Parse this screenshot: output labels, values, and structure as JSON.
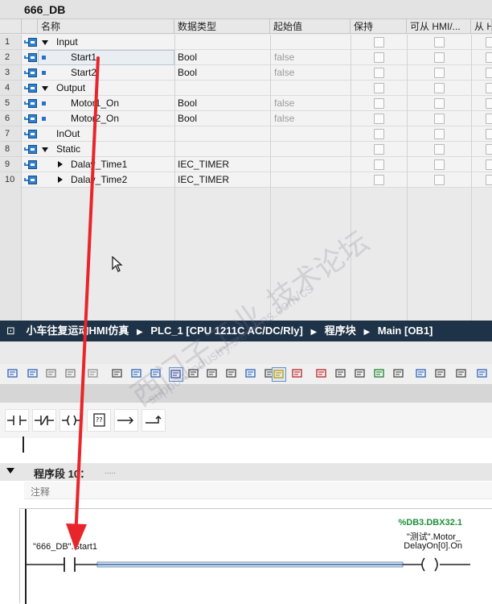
{
  "db": {
    "title": "666_DB",
    "columns": [
      "名称",
      "数据类型",
      "起始值",
      "保持",
      "可从 HMI/...",
      "从 H"
    ],
    "rows": [
      {
        "num": "1",
        "name": "Input",
        "type": "",
        "start": "",
        "level": 0,
        "expander": "down"
      },
      {
        "num": "2",
        "name": "Start1",
        "type": "Bool",
        "start": "false",
        "level": 1,
        "expander": "none"
      },
      {
        "num": "3",
        "name": "Start2",
        "type": "Bool",
        "start": "false",
        "level": 1,
        "expander": "none"
      },
      {
        "num": "4",
        "name": "Output",
        "type": "",
        "start": "",
        "level": 0,
        "expander": "down"
      },
      {
        "num": "5",
        "name": "Motor1_On",
        "type": "Bool",
        "start": "false",
        "level": 1,
        "expander": "none"
      },
      {
        "num": "6",
        "name": "Motor2_On",
        "type": "Bool",
        "start": "false",
        "level": 1,
        "expander": "none"
      },
      {
        "num": "7",
        "name": "InOut",
        "type": "",
        "start": "",
        "level": 0,
        "expander": "none"
      },
      {
        "num": "8",
        "name": "Static",
        "type": "",
        "start": "",
        "level": 0,
        "expander": "down"
      },
      {
        "num": "9",
        "name": "Dalay_Time1",
        "type": "IEC_TIMER",
        "start": "",
        "level": 1,
        "expander": "right"
      },
      {
        "num": "10",
        "name": "Dalay_Time2",
        "type": "IEC_TIMER",
        "start": "",
        "level": 1,
        "expander": "right"
      }
    ]
  },
  "breadcrumb": {
    "project": "小车往复运动HMI仿真",
    "plc": "PLC_1 [CPU 1211C AC/DC/Rly]",
    "folder": "程序块",
    "block": "Main [OB1]"
  },
  "network": {
    "title": "程序段 10：",
    "dots": ".....",
    "comment": "注释",
    "contact_operand": "\"666_DB\".Start1",
    "coil_address": "%DB3.DBX32.1",
    "coil_operand_line1": "\"测试\".Motor_",
    "coil_operand_line2": "DelayOn[0].On"
  },
  "watermark": {
    "line1": "西门子工业",
    "line2": "support.industry.siemens.com/cs",
    "line3": "技术论坛"
  },
  "annotation": {
    "arrow_color": "#e8252a"
  },
  "icons": [
    "db-member-icon",
    "expand-triangle-icon",
    "contact-no-icon",
    "contact-nc-icon",
    "coil-icon",
    "box-icon",
    "branch-open-icon",
    "branch-close-icon"
  ]
}
